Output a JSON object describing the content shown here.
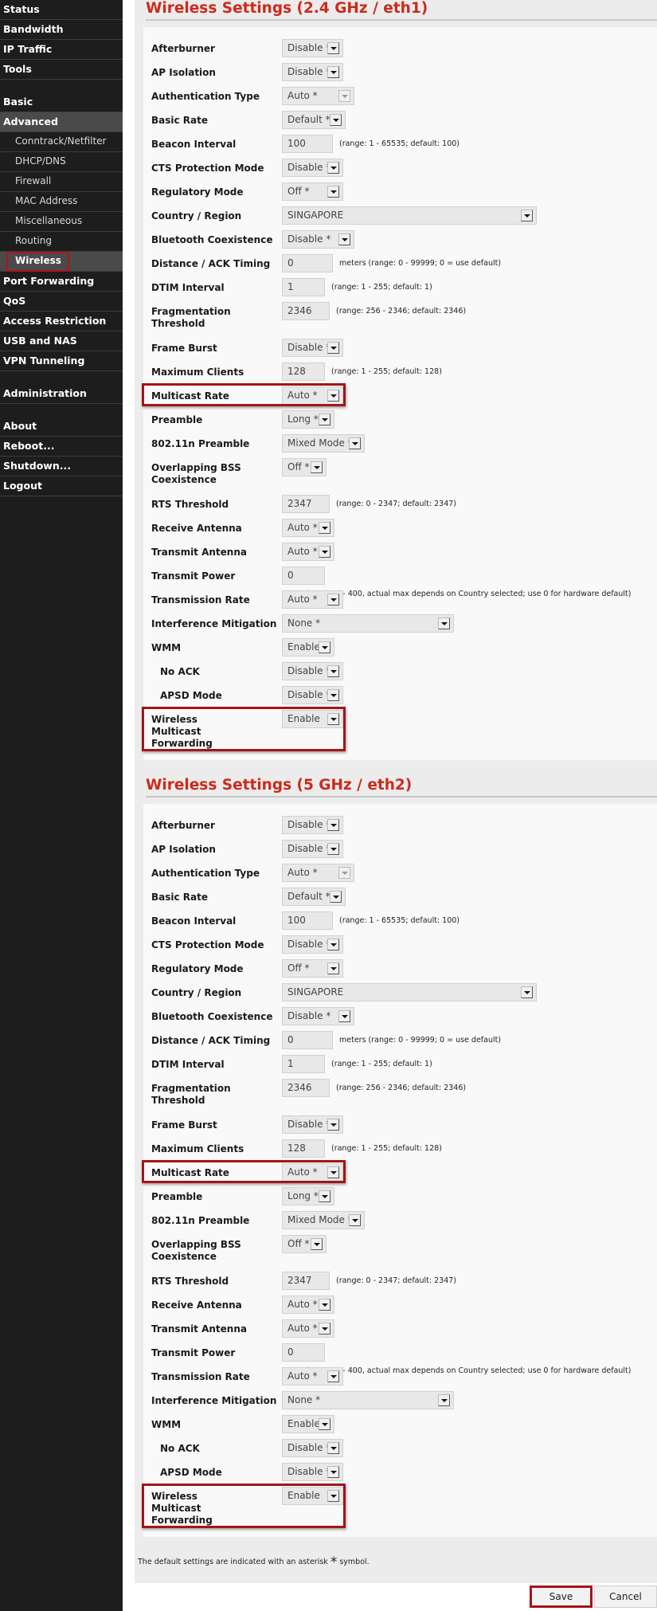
{
  "sidebar": {
    "items": [
      {
        "label": "Status",
        "type": "top"
      },
      {
        "label": "Bandwidth",
        "type": "top"
      },
      {
        "label": "IP Traffic",
        "type": "top"
      },
      {
        "label": "Tools",
        "type": "top"
      },
      {
        "type": "gap"
      },
      {
        "label": "Basic",
        "type": "top"
      },
      {
        "label": "Advanced",
        "type": "top",
        "active": true
      },
      {
        "label": "Conntrack/Netfilter",
        "type": "sub"
      },
      {
        "label": "DHCP/DNS",
        "type": "sub"
      },
      {
        "label": "Firewall",
        "type": "sub"
      },
      {
        "label": "MAC Address",
        "type": "sub"
      },
      {
        "label": "Miscellaneous",
        "type": "sub"
      },
      {
        "label": "Routing",
        "type": "sub"
      },
      {
        "label": "Wireless",
        "type": "sub",
        "active": true,
        "highlighted": true
      },
      {
        "label": "Port Forwarding",
        "type": "top"
      },
      {
        "label": "QoS",
        "type": "top"
      },
      {
        "label": "Access Restriction",
        "type": "top"
      },
      {
        "label": "USB and NAS",
        "type": "top"
      },
      {
        "label": "VPN Tunneling",
        "type": "top"
      },
      {
        "type": "gap"
      },
      {
        "label": "Administration",
        "type": "top"
      },
      {
        "type": "gap"
      },
      {
        "label": "About",
        "type": "top"
      },
      {
        "label": "Reboot...",
        "type": "top"
      },
      {
        "label": "Shutdown...",
        "type": "top"
      },
      {
        "label": "Logout",
        "type": "top"
      }
    ]
  },
  "sections": [
    {
      "title": "Wireless Settings (2.4 GHz / eth1)",
      "rows": [
        {
          "label": "Afterburner",
          "kind": "select",
          "value": "Disable *",
          "w": "m"
        },
        {
          "label": "AP Isolation",
          "kind": "select",
          "value": "Disable *",
          "w": "m"
        },
        {
          "label": "Authentication Type",
          "kind": "select",
          "value": "Auto *",
          "w": "l",
          "dim": true
        },
        {
          "label": "Basic Rate",
          "kind": "select",
          "value": "Default *",
          "w": "m2"
        },
        {
          "label": "Beacon Interval",
          "kind": "text",
          "value": "100",
          "w": "t3",
          "hint": "(range: 1 - 65535; default: 100)"
        },
        {
          "label": "CTS Protection Mode",
          "kind": "select",
          "value": "Disable *",
          "w": "m"
        },
        {
          "label": "Regulatory Mode",
          "kind": "select",
          "value": "Off *",
          "w": "m"
        },
        {
          "label": "Country / Region",
          "kind": "select",
          "value": "SINGAPORE",
          "w": "xl"
        },
        {
          "label": "Bluetooth Coexistence",
          "kind": "select",
          "value": "Disable *",
          "w": "l"
        },
        {
          "label": "Distance / ACK Timing",
          "kind": "text",
          "value": "0",
          "w": "t3",
          "hint": "meters  (range: 0 - 99999; 0 = use default)"
        },
        {
          "label": "DTIM Interval",
          "kind": "text",
          "value": "1",
          "w": "t2",
          "hint": "(range: 1 - 255; default: 1)"
        },
        {
          "label": "Fragmentation Threshold",
          "kind": "text",
          "value": "2346",
          "w": "t25",
          "hint": "(range: 256 - 2346; default: 2346)",
          "tall": true
        },
        {
          "label": "Frame Burst",
          "kind": "select",
          "value": "Disable *",
          "w": "m"
        },
        {
          "label": "Maximum Clients",
          "kind": "text",
          "value": "128",
          "w": "t2",
          "hint": "(range: 1 - 255; default: 128)"
        },
        {
          "label": "Multicast Rate",
          "kind": "select",
          "value": "Auto *",
          "w": "m",
          "highlighted": true
        },
        {
          "label": "Preamble",
          "kind": "select",
          "value": "Long *",
          "w": "s"
        },
        {
          "label": "802.11n Preamble",
          "kind": "select",
          "value": "Mixed Mode *",
          "w": "mm"
        },
        {
          "label": "Overlapping BSS Coexistence",
          "kind": "select",
          "value": "Off *",
          "w": "s2",
          "tall": true
        },
        {
          "label": "RTS Threshold",
          "kind": "text",
          "value": "2347",
          "w": "t25",
          "hint": "(range: 0 - 2347; default: 2347)"
        },
        {
          "label": "Receive Antenna",
          "kind": "select",
          "value": "Auto *",
          "w": "s"
        },
        {
          "label": "Transmit Antenna",
          "kind": "select",
          "value": "Auto *",
          "w": "s"
        },
        {
          "label": "Transmit Power",
          "kind": "text",
          "value": "0",
          "w": "t2",
          "hint": "mW  (range: 0 - 400, actual max depends on Country selected; use 0 for hardware default)"
        },
        {
          "label": "Transmission Rate",
          "kind": "select",
          "value": "Auto *",
          "w": "m"
        },
        {
          "label": "Interference Mitigation",
          "kind": "select",
          "value": "None *",
          "w": "lg"
        },
        {
          "label": "WMM",
          "kind": "select",
          "value": "Enable",
          "w": "s"
        },
        {
          "label": "No ACK",
          "kind": "select",
          "value": "Disable *",
          "w": "m",
          "indent": true
        },
        {
          "label": "APSD Mode",
          "kind": "select",
          "value": "Disable *",
          "w": "m",
          "indent": true
        },
        {
          "label": "Wireless Multicast Forwarding",
          "kind": "select",
          "value": "Enable",
          "w": "m",
          "tall": true,
          "highlighted": true
        }
      ]
    },
    {
      "title": "Wireless Settings (5 GHz / eth2)",
      "rows": [
        {
          "label": "Afterburner",
          "kind": "select",
          "value": "Disable *",
          "w": "m"
        },
        {
          "label": "AP Isolation",
          "kind": "select",
          "value": "Disable *",
          "w": "m"
        },
        {
          "label": "Authentication Type",
          "kind": "select",
          "value": "Auto *",
          "w": "l",
          "dim": true
        },
        {
          "label": "Basic Rate",
          "kind": "select",
          "value": "Default *",
          "w": "m2"
        },
        {
          "label": "Beacon Interval",
          "kind": "text",
          "value": "100",
          "w": "t3",
          "hint": "(range: 1 - 65535; default: 100)"
        },
        {
          "label": "CTS Protection Mode",
          "kind": "select",
          "value": "Disable *",
          "w": "m"
        },
        {
          "label": "Regulatory Mode",
          "kind": "select",
          "value": "Off *",
          "w": "m"
        },
        {
          "label": "Country / Region",
          "kind": "select",
          "value": "SINGAPORE",
          "w": "xl"
        },
        {
          "label": "Bluetooth Coexistence",
          "kind": "select",
          "value": "Disable *",
          "w": "l"
        },
        {
          "label": "Distance / ACK Timing",
          "kind": "text",
          "value": "0",
          "w": "t3",
          "hint": "meters  (range: 0 - 99999; 0 = use default)"
        },
        {
          "label": "DTIM Interval",
          "kind": "text",
          "value": "1",
          "w": "t2",
          "hint": "(range: 1 - 255; default: 1)"
        },
        {
          "label": "Fragmentation Threshold",
          "kind": "text",
          "value": "2346",
          "w": "t25",
          "hint": "(range: 256 - 2346; default: 2346)",
          "tall": true
        },
        {
          "label": "Frame Burst",
          "kind": "select",
          "value": "Disable *",
          "w": "m"
        },
        {
          "label": "Maximum Clients",
          "kind": "text",
          "value": "128",
          "w": "t2",
          "hint": "(range: 1 - 255; default: 128)"
        },
        {
          "label": "Multicast Rate",
          "kind": "select",
          "value": "Auto *",
          "w": "m",
          "highlighted": true
        },
        {
          "label": "Preamble",
          "kind": "select",
          "value": "Long *",
          "w": "s"
        },
        {
          "label": "802.11n Preamble",
          "kind": "select",
          "value": "Mixed Mode *",
          "w": "mm"
        },
        {
          "label": "Overlapping BSS Coexistence",
          "kind": "select",
          "value": "Off *",
          "w": "s2",
          "tall": true
        },
        {
          "label": "RTS Threshold",
          "kind": "text",
          "value": "2347",
          "w": "t25",
          "hint": "(range: 0 - 2347; default: 2347)"
        },
        {
          "label": "Receive Antenna",
          "kind": "select",
          "value": "Auto *",
          "w": "s"
        },
        {
          "label": "Transmit Antenna",
          "kind": "select",
          "value": "Auto *",
          "w": "s"
        },
        {
          "label": "Transmit Power",
          "kind": "text",
          "value": "0",
          "w": "t2",
          "hint": "mW  (range: 0 - 400, actual max depends on Country selected; use 0 for hardware default)"
        },
        {
          "label": "Transmission Rate",
          "kind": "select",
          "value": "Auto *",
          "w": "m"
        },
        {
          "label": "Interference Mitigation",
          "kind": "select",
          "value": "None *",
          "w": "lg"
        },
        {
          "label": "WMM",
          "kind": "select",
          "value": "Enable",
          "w": "s"
        },
        {
          "label": "No ACK",
          "kind": "select",
          "value": "Disable *",
          "w": "m",
          "indent": true
        },
        {
          "label": "APSD Mode",
          "kind": "select",
          "value": "Disable *",
          "w": "m",
          "indent": true
        },
        {
          "label": "Wireless Multicast Forwarding",
          "kind": "select",
          "value": "Enable",
          "w": "m",
          "tall": true,
          "highlighted": true
        }
      ]
    }
  ],
  "footer": {
    "note_before": "The default settings are indicated with an asterisk",
    "note_asterisk": "*",
    "note_after": "symbol."
  },
  "buttons": {
    "save": "Save",
    "cancel": "Cancel"
  },
  "colors": {
    "accent": "#cc2a1b",
    "highlight": "#a3151a",
    "sidebar_bg": "#1d1d1d"
  }
}
